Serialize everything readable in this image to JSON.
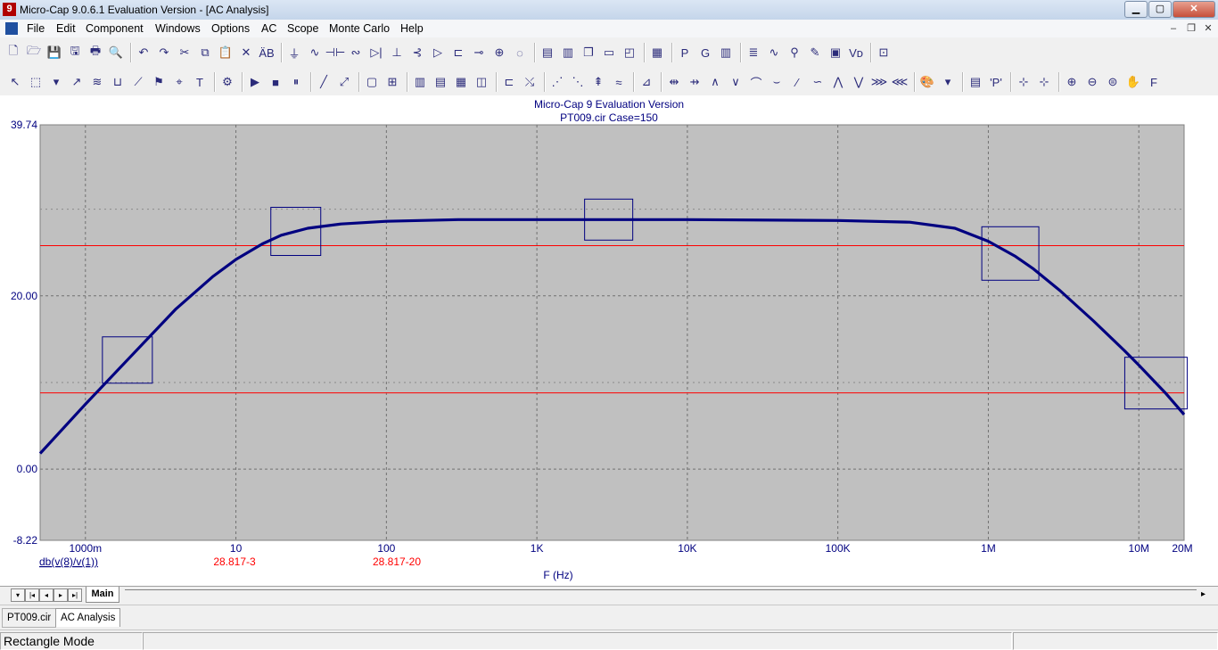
{
  "window": {
    "title": "Micro-Cap 9.0.6.1 Evaluation Version - [AC Analysis]",
    "app_icon_glyph": "9",
    "minimize_glyph": "▁",
    "maximize_glyph": "▢",
    "close_glyph": "✕",
    "mdi_minimize": "–",
    "mdi_restore": "❐",
    "mdi_close": "✕"
  },
  "menu": {
    "items": [
      "File",
      "Edit",
      "Component",
      "Windows",
      "Options",
      "AC",
      "Scope",
      "Monte Carlo",
      "Help"
    ]
  },
  "toolbar1": {
    "items": [
      {
        "name": "new-icon",
        "glyph": "🗋"
      },
      {
        "name": "open-icon",
        "glyph": "🗁"
      },
      {
        "name": "save-icon",
        "glyph": "💾"
      },
      {
        "name": "save-all-icon",
        "glyph": "🖫"
      },
      {
        "name": "print-icon",
        "glyph": "🖶"
      },
      {
        "name": "print-preview-icon",
        "glyph": "🔍"
      },
      {
        "sep": true
      },
      {
        "name": "undo-icon",
        "glyph": "↶"
      },
      {
        "name": "redo-icon",
        "glyph": "↷"
      },
      {
        "name": "cut-icon",
        "glyph": "✂"
      },
      {
        "name": "copy-icon",
        "glyph": "⧉"
      },
      {
        "name": "paste-icon",
        "glyph": "📋"
      },
      {
        "name": "delete-icon",
        "glyph": "✕"
      },
      {
        "name": "find-icon",
        "glyph": "ÄB"
      },
      {
        "sep": true
      },
      {
        "name": "ground-icon",
        "glyph": "⏚"
      },
      {
        "name": "resistor-icon",
        "glyph": "∿"
      },
      {
        "name": "capacitor-icon",
        "glyph": "⊣⊢"
      },
      {
        "name": "inductor-icon",
        "glyph": "∾"
      },
      {
        "name": "diode-icon",
        "glyph": "▷|"
      },
      {
        "name": "battery-icon",
        "glyph": "⊥"
      },
      {
        "name": "npn-icon",
        "glyph": "⊰"
      },
      {
        "name": "opamp-icon",
        "glyph": "▷"
      },
      {
        "name": "jfet-icon",
        "glyph": "⊏"
      },
      {
        "name": "switch-icon",
        "glyph": "⊸"
      },
      {
        "name": "source-icon",
        "glyph": "⊕"
      },
      {
        "name": "ac-source-icon",
        "glyph": "◌"
      },
      {
        "sep": true
      },
      {
        "name": "tile-horizontal-icon",
        "glyph": "▤"
      },
      {
        "name": "tile-vertical-icon",
        "glyph": "▥"
      },
      {
        "name": "cascade-icon",
        "glyph": "❐"
      },
      {
        "name": "window-icon",
        "glyph": "▭"
      },
      {
        "name": "split-window-icon",
        "glyph": "◰"
      },
      {
        "sep": true
      },
      {
        "name": "calculator-icon",
        "glyph": "▦"
      },
      {
        "sep": true
      },
      {
        "name": "probe-p-icon",
        "glyph": "P"
      },
      {
        "name": "probe-g-icon",
        "glyph": "G"
      },
      {
        "name": "grid-table-icon",
        "glyph": "▥"
      },
      {
        "sep": true
      },
      {
        "name": "numeric-output-icon",
        "glyph": "≣"
      },
      {
        "name": "waveform-icon",
        "glyph": "∿"
      },
      {
        "name": "probe-icon",
        "glyph": "⚲"
      },
      {
        "name": "pen-icon",
        "glyph": "✎"
      },
      {
        "name": "animate-icon",
        "glyph": "▣"
      },
      {
        "name": "vd-icon",
        "glyph": "Vᴅ"
      },
      {
        "sep": true
      },
      {
        "name": "zoom-frame-icon",
        "glyph": "⊡"
      }
    ]
  },
  "toolbar2": {
    "items": [
      {
        "name": "select-mode-icon",
        "glyph": "↖"
      },
      {
        "name": "rectangle-mode-icon",
        "glyph": "⬚"
      },
      {
        "name": "dropdown-arrow-icon",
        "glyph": "▾"
      },
      {
        "name": "draw-line-icon",
        "glyph": "↗"
      },
      {
        "name": "text-wave-icon",
        "glyph": "≋"
      },
      {
        "name": "box-icon",
        "glyph": "⊔"
      },
      {
        "name": "node-icon",
        "glyph": "⟋"
      },
      {
        "name": "flag-icon",
        "glyph": "⚑"
      },
      {
        "name": "tag-icon",
        "glyph": "⌖"
      },
      {
        "name": "text-icon",
        "glyph": "T"
      },
      {
        "sep": true
      },
      {
        "name": "properties-icon",
        "glyph": "⚙"
      },
      {
        "sep": true
      },
      {
        "name": "run-icon",
        "glyph": "▶"
      },
      {
        "name": "stop-icon",
        "glyph": "■"
      },
      {
        "name": "pause-icon",
        "glyph": "⏸"
      },
      {
        "sep": true
      },
      {
        "name": "line-icon",
        "glyph": "╱"
      },
      {
        "name": "arrow-line-icon",
        "glyph": "⤢"
      },
      {
        "sep": true
      },
      {
        "name": "box-grid-icon",
        "glyph": "▢"
      },
      {
        "name": "grid-icon",
        "glyph": "⊞"
      },
      {
        "sep": true
      },
      {
        "name": "vertical-grid-icon",
        "glyph": "▥"
      },
      {
        "name": "horizontal-grid-icon",
        "glyph": "▤"
      },
      {
        "name": "minor-grid-icon",
        "glyph": "▦"
      },
      {
        "name": "major-grid-icon",
        "glyph": "◫"
      },
      {
        "sep": true
      },
      {
        "name": "bottom-axis-icon",
        "glyph": "⊏"
      },
      {
        "name": "trace-icon",
        "glyph": "⤯"
      },
      {
        "sep": true
      },
      {
        "name": "peak-icon",
        "glyph": "⋰"
      },
      {
        "name": "valley-icon",
        "glyph": "⋱"
      },
      {
        "name": "high-icon",
        "glyph": "⇞"
      },
      {
        "name": "wave-icon",
        "glyph": "≈"
      },
      {
        "sep": true
      },
      {
        "name": "scope-icon",
        "glyph": "⊿"
      },
      {
        "sep": true
      },
      {
        "name": "cursor-left-icon",
        "glyph": "⇹"
      },
      {
        "name": "cursor-right-icon",
        "glyph": "⇸"
      },
      {
        "name": "peak-find-icon",
        "glyph": "∧"
      },
      {
        "name": "valley-find-icon",
        "glyph": "∨"
      },
      {
        "name": "next-peak-icon",
        "glyph": "⌒"
      },
      {
        "name": "next-valley-icon",
        "glyph": "⌣"
      },
      {
        "name": "slope-icon",
        "glyph": "∕"
      },
      {
        "name": "inflection-icon",
        "glyph": "∽"
      },
      {
        "name": "global-high-icon",
        "glyph": "⋀"
      },
      {
        "name": "global-low-icon",
        "glyph": "⋁"
      },
      {
        "name": "multi-peak-icon",
        "glyph": "⋙"
      },
      {
        "name": "multi-valley-icon",
        "glyph": "⋘"
      },
      {
        "sep": true
      },
      {
        "name": "paint-icon",
        "glyph": "🎨"
      },
      {
        "name": "paint-dropdown-icon",
        "glyph": "▾"
      },
      {
        "sep": true
      },
      {
        "name": "table-icon",
        "glyph": "▤"
      },
      {
        "name": "point-tag-icon",
        "glyph": "'P'"
      },
      {
        "sep": true
      },
      {
        "name": "tag-horizontal-icon",
        "glyph": "⊹"
      },
      {
        "name": "tag-vertical-icon",
        "glyph": "⊹"
      },
      {
        "sep": true
      },
      {
        "name": "zoom-in-icon",
        "glyph": "⊕"
      },
      {
        "name": "zoom-out-icon",
        "glyph": "⊖"
      },
      {
        "name": "zoom-fit-icon",
        "glyph": "⊜"
      },
      {
        "name": "pan-icon",
        "glyph": "✋"
      },
      {
        "name": "font-icon",
        "glyph": "F"
      }
    ]
  },
  "plot": {
    "header_line1": "Micro-Cap 9 Evaluation Version",
    "header_line2": "PT009.cir Case=150",
    "x_title": "F (Hz)",
    "y_ticks": [
      "39.74",
      "20.00",
      "0.00",
      "-8.22"
    ],
    "x_ticks": [
      "1000m",
      "10",
      "100",
      "1K",
      "10K",
      "100K",
      "1M",
      "10M",
      "20M"
    ],
    "trace_label": "db(v(8)/v(1))",
    "cursor_label_left": "28.817-3",
    "cursor_label_right": "28.817-20",
    "colors": {
      "trace": "#000080",
      "cursor": "#ff0000",
      "plot_bg": "#c0c0c0",
      "axis_text": "#000080",
      "label_red": "#ff0000"
    }
  },
  "chart_data": {
    "type": "line",
    "title": "Micro-Cap 9 Evaluation Version",
    "subtitle": "PT009.cir Case=150",
    "xlabel": "F (Hz)",
    "ylabel": "",
    "x_scale": "log",
    "xlim": [
      0.5,
      20000000
    ],
    "ylim": [
      -8.22,
      39.74
    ],
    "grid": true,
    "x_ticks": [
      1,
      10,
      100,
      1000,
      10000,
      100000,
      1000000,
      10000000,
      20000000
    ],
    "y_ticks": [
      -8.22,
      0,
      20,
      39.74
    ],
    "horizontal_cursors": [
      25.8,
      8.8
    ],
    "series": [
      {
        "name": "db(v(8)/v(1))",
        "x": [
          0.5,
          1,
          2,
          4,
          7,
          10,
          15,
          20,
          30,
          50,
          100,
          300,
          1000,
          10000,
          100000,
          300000,
          600000,
          1000000,
          1500000,
          2000000,
          3000000,
          5000000,
          8000000,
          10000000,
          15000000,
          20000000
        ],
        "y": [
          1.8,
          7.5,
          13.0,
          18.5,
          22.2,
          24.2,
          26.0,
          27.0,
          27.8,
          28.3,
          28.6,
          28.8,
          28.8,
          28.8,
          28.7,
          28.5,
          27.8,
          26.3,
          24.6,
          23.1,
          20.6,
          17.1,
          13.7,
          12.0,
          8.8,
          6.3
        ]
      }
    ],
    "box_markers_x": [
      1.9,
      25,
      3000,
      1400000,
      13000000
    ]
  },
  "sheets": {
    "nav": [
      "▾",
      "|◂",
      "◂",
      "▸",
      "▸|"
    ],
    "active": "Main"
  },
  "doc_tabs": [
    "PT009.cir",
    "AC Analysis"
  ],
  "status": {
    "mode": "Rectangle Mode"
  }
}
